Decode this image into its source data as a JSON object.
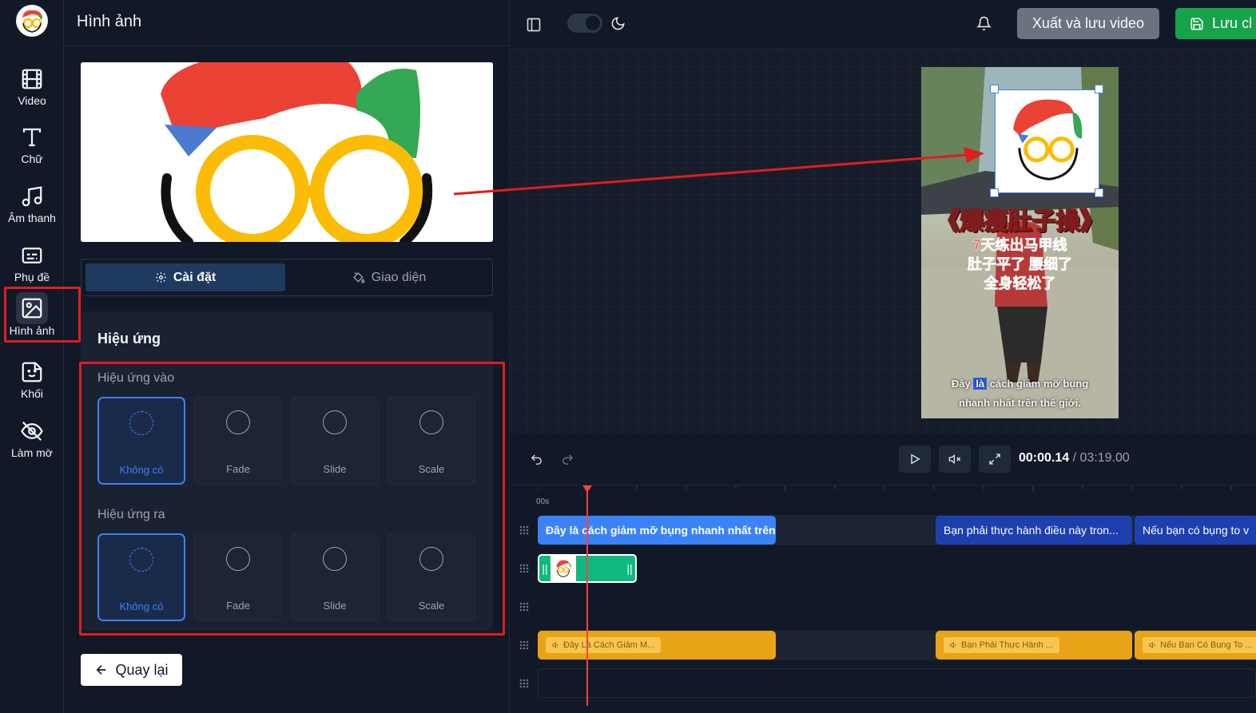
{
  "sidebar": {
    "items": [
      {
        "label": "Video",
        "icon": "film-icon"
      },
      {
        "label": "Chữ",
        "icon": "text-icon"
      },
      {
        "label": "Âm thanh",
        "icon": "music-icon"
      },
      {
        "label": "Phụ đề",
        "icon": "subtitles-icon"
      },
      {
        "label": "Hình ảnh",
        "icon": "image-icon",
        "active": true
      },
      {
        "label": "Khối",
        "icon": "sticker-icon"
      },
      {
        "label": "Làm mờ",
        "icon": "eye-off-icon"
      }
    ]
  },
  "panel": {
    "title": "Hình ảnh",
    "tabs": [
      {
        "label": "Cài đặt",
        "active": true
      },
      {
        "label": "Giao diện",
        "active": false
      }
    ],
    "effects": {
      "title": "Hiệu ứng",
      "in_label": "Hiệu ứng vào",
      "out_label": "Hiệu ứng ra",
      "in_options": [
        "Không có",
        "Fade",
        "Slide",
        "Scale"
      ],
      "out_options": [
        "Không có",
        "Fade",
        "Slide",
        "Scale"
      ],
      "selected_in": "Không có",
      "selected_out": "Không có"
    },
    "back_label": "Quay lại"
  },
  "topbar": {
    "export_label": "Xuất và lưu video",
    "save_label": "Lưu cl"
  },
  "video": {
    "title": "《爆瘦肚子操》",
    "sub_lines": [
      "7天练出马甲线",
      "肚子平了 腰细了",
      "全身轻松了"
    ],
    "caption": {
      "line1_before": "Đây",
      "line1_highlight": "là",
      "line1_after": "cách giảm mỡ bụng",
      "line2": "nhanh nhất trên thế giới."
    }
  },
  "player": {
    "current_time": "00:00.14",
    "separator": "/",
    "total_time": "03:19.00"
  },
  "timeline": {
    "ruler_start": "00s",
    "text_clips": [
      "Đây là cách giảm mỡ bụng nhanh nhất trên t",
      "Bạn phải thực hành điều này tron...",
      "Nếu bạn có bụng to v"
    ],
    "audio_clips": [
      "Đây Là Cách Giảm M...",
      "Bạn Phải Thực Hành ...",
      "Nếu Bạn Có Bụng To ..."
    ]
  },
  "colors": {
    "accent": "#3b82f6",
    "save": "#16a34a",
    "highlight_box": "#e11d1d",
    "audio_clip": "#e8a317"
  }
}
